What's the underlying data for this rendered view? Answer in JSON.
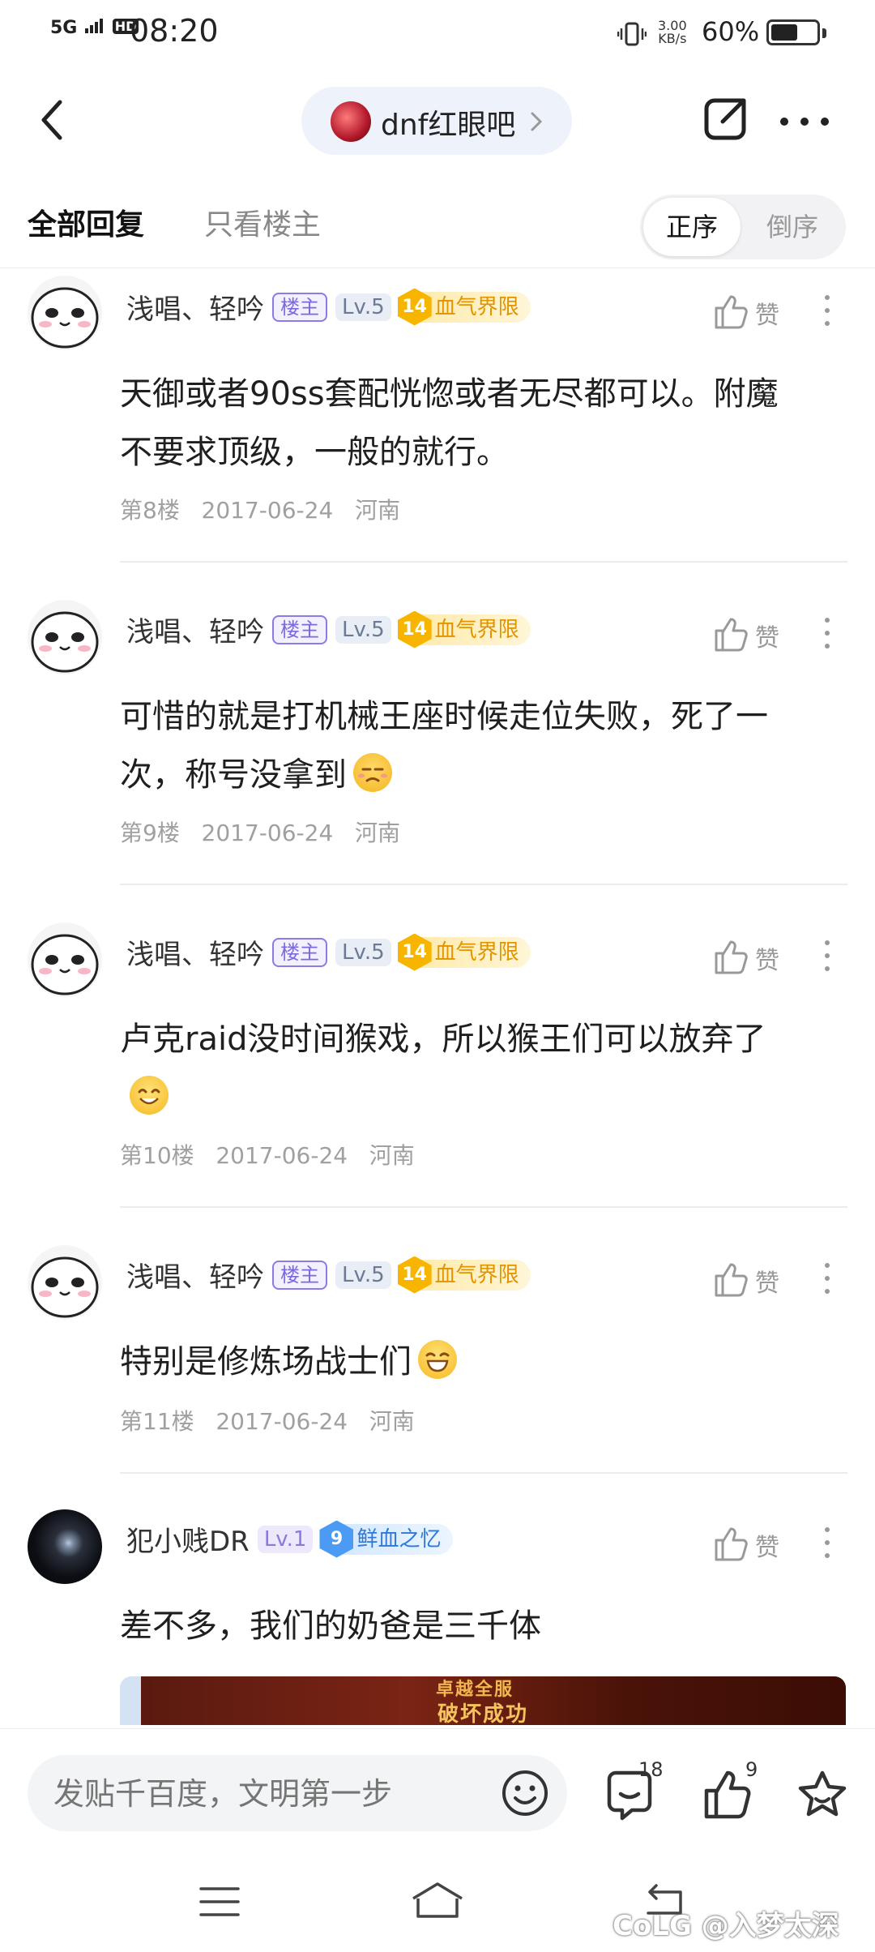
{
  "status_bar": {
    "signal": "5G",
    "hd": "HD",
    "time": "08:20",
    "rate_value": "3.00",
    "rate_unit": "KB/s",
    "battery": "60%",
    "battery_level": 0.6
  },
  "nav": {
    "forum_name": "dnf红眼吧"
  },
  "tabs": {
    "all": "全部回复",
    "owner_only": "只看楼主",
    "sort_asc": "正序",
    "sort_desc": "倒序"
  },
  "posts": [
    {
      "username": "浅唱、轻吟",
      "owner_badge": "楼主",
      "level": "Lv.5",
      "title_level": "14",
      "title": "血气界限",
      "like_label": "赞",
      "content_line1": "天御或者90ss套配恍惚或者无尽都可以。附魔",
      "content_line2": "不要求顶级，一般的就行。",
      "floor": "第8楼",
      "date": "2017-06-24",
      "location": "河南"
    },
    {
      "username": "浅唱、轻吟",
      "owner_badge": "楼主",
      "level": "Lv.5",
      "title_level": "14",
      "title": "血气界限",
      "like_label": "赞",
      "content_line1": "可惜的就是打机械王座时候走位失败，死了一",
      "content_line2": "次，称号没拿到",
      "floor": "第9楼",
      "date": "2017-06-24",
      "location": "河南"
    },
    {
      "username": "浅唱、轻吟",
      "owner_badge": "楼主",
      "level": "Lv.5",
      "title_level": "14",
      "title": "血气界限",
      "like_label": "赞",
      "content_line1": "卢克raid没时间猴戏，所以猴王们可以放弃了",
      "floor": "第10楼",
      "date": "2017-06-24",
      "location": "河南"
    },
    {
      "username": "浅唱、轻吟",
      "owner_badge": "楼主",
      "level": "Lv.5",
      "title_level": "14",
      "title": "血气界限",
      "like_label": "赞",
      "content_line1": "特别是修炼场战士们",
      "floor": "第11楼",
      "date": "2017-06-24",
      "location": "河南"
    },
    {
      "username": "犯小贱DR",
      "level": "Lv.1",
      "title_level": "9",
      "title": "鲜血之忆",
      "like_label": "赞",
      "content_line1": "差不多，我们的奶爸是三千体",
      "image_text_top": "卓越全服",
      "image_text_bottom": "破坏成功"
    }
  ],
  "bottom_bar": {
    "input_placeholder": "发贴千百度，文明第一步",
    "comment_count": "18",
    "like_count": "9"
  },
  "watermark": "CoLG @入梦太深",
  "colors": {
    "accent_purple": "#7b69e0",
    "gold": "#f7b500",
    "blue": "#4b9bf5",
    "meta_gray": "#a0a0a0"
  }
}
